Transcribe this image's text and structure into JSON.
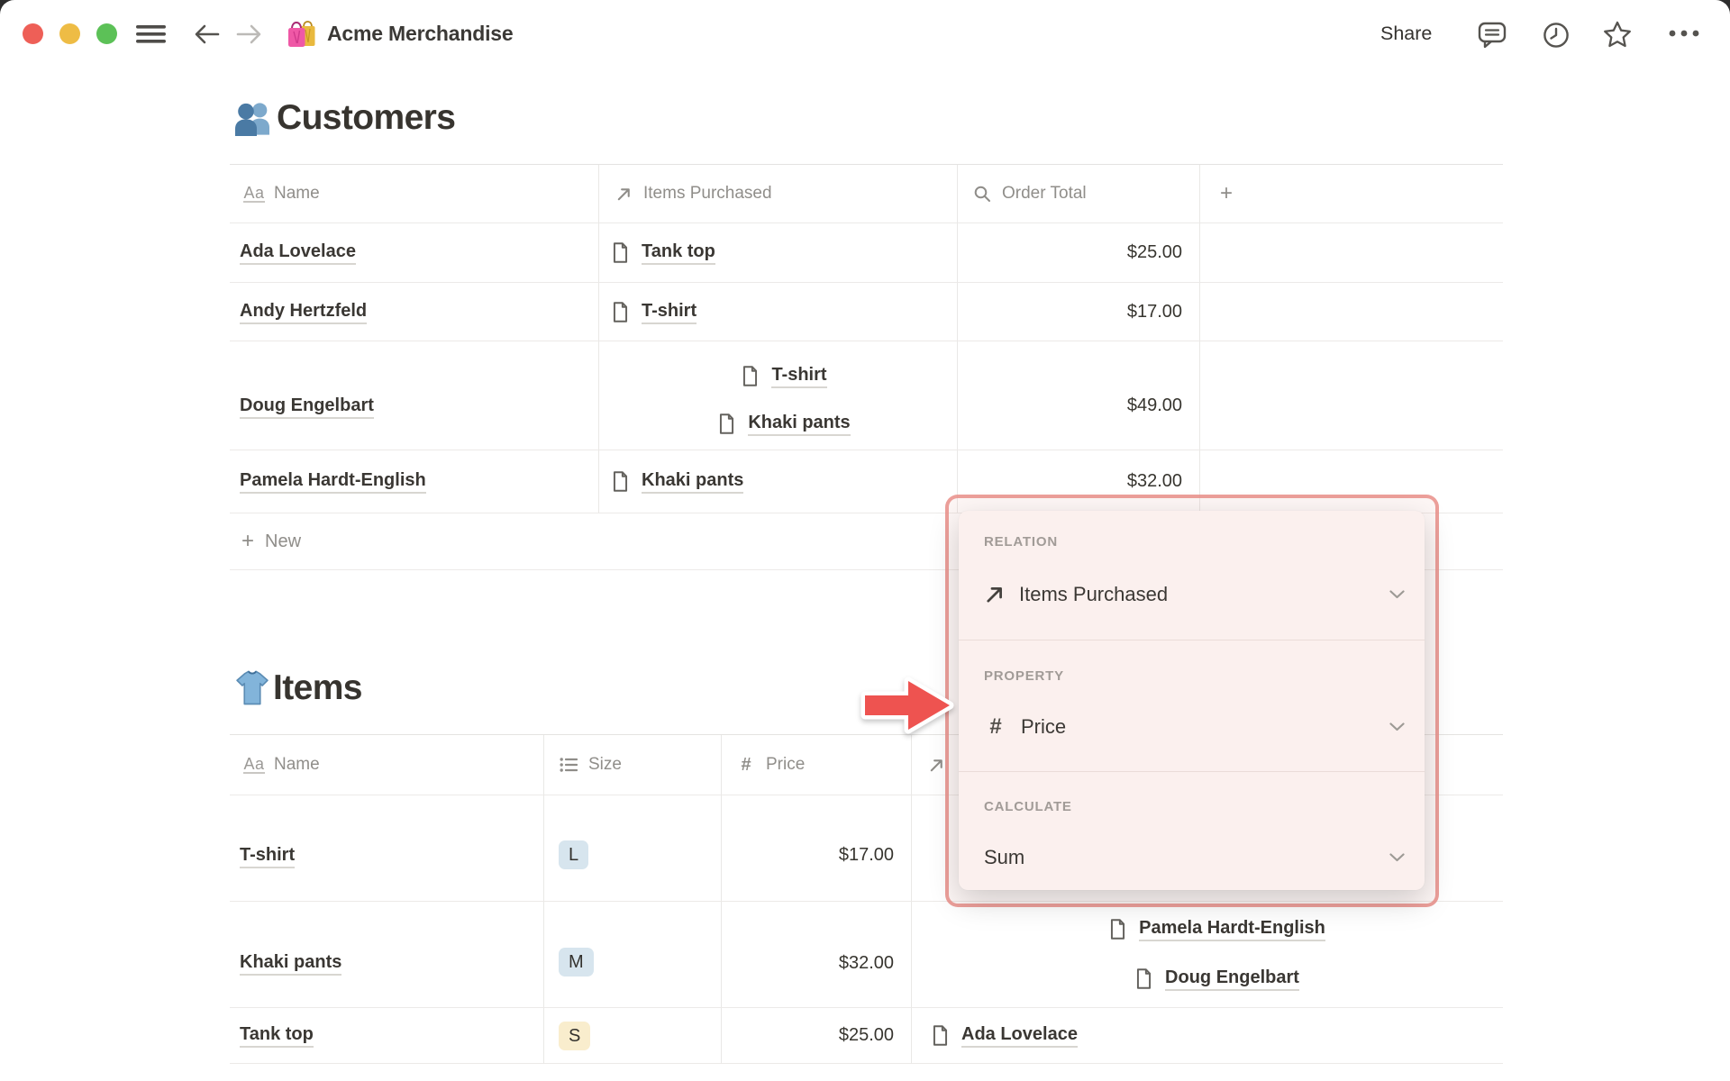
{
  "window": {
    "title": "Acme Merchandise",
    "share_label": "Share",
    "icons": [
      "hamburger-icon",
      "back-icon",
      "forward-icon",
      "shopping-bags-icon",
      "comment-icon",
      "history-clock-icon",
      "star-icon",
      "ellipsis-icon"
    ]
  },
  "customers_table": {
    "title": "Customers",
    "title_icon": "people-icon",
    "columns": [
      {
        "label": "Name",
        "icon": "text-aa-icon"
      },
      {
        "label": "Items Purchased",
        "icon": "relation-arrow-icon"
      },
      {
        "label": "Order Total",
        "icon": "rollup-magnifier-icon"
      },
      {
        "label": "+",
        "icon": "add-column-icon"
      }
    ],
    "rows": [
      {
        "name": "Ada Lovelace",
        "items": [
          "Tank top"
        ],
        "order_total": "$25.00"
      },
      {
        "name": "Andy Hertzfeld",
        "items": [
          "T-shirt"
        ],
        "order_total": "$17.00"
      },
      {
        "name": "Doug Engelbart",
        "items": [
          "T-shirt",
          "Khaki pants"
        ],
        "order_total": "$49.00"
      },
      {
        "name": "Pamela Hardt-English",
        "items": [
          "Khaki pants"
        ],
        "order_total": "$32.00"
      }
    ],
    "new_row_label": "New"
  },
  "items_table": {
    "title": "Items",
    "title_icon": "tshirt-icon",
    "columns": [
      {
        "label": "Name",
        "icon": "text-aa-icon"
      },
      {
        "label": "Size",
        "icon": "select-list-icon"
      },
      {
        "label": "Price",
        "icon": "number-hash-icon"
      },
      {
        "label": "",
        "icon": "relation-arrow-icon",
        "note": "header text hidden behind popup"
      }
    ],
    "rows": [
      {
        "name": "T-shirt",
        "size": "L",
        "size_color": "blue",
        "price": "$17.00",
        "purchasers": [],
        "purchaser_icons_visible": 2
      },
      {
        "name": "Khaki pants",
        "size": "M",
        "size_color": "blue",
        "price": "$32.00",
        "purchasers": [
          "Pamela Hardt-English",
          "Doug Engelbart"
        ]
      },
      {
        "name": "Tank top",
        "size": "S",
        "size_color": "yellow",
        "price": "$25.00",
        "purchasers": [
          "Ada Lovelace"
        ]
      }
    ]
  },
  "popup": {
    "relation_label": "RELATION",
    "relation_value": "Items Purchased",
    "relation_icon": "relation-arrow-icon",
    "property_label": "PROPERTY",
    "property_value": "Price",
    "property_icon": "number-hash-icon",
    "calculate_label": "CALCULATE",
    "calculate_value": "Sum"
  },
  "colors": {
    "ring_accent": "#ea908b",
    "popup_bg": "#fbf0ee",
    "arrow_red": "#ee5350",
    "chip_blue": "#d7e5ee",
    "chip_yellow": "#f9edcd",
    "traffic_red": "#ee5f57",
    "traffic_yellow": "#eebc45",
    "traffic_green": "#5cc157"
  }
}
